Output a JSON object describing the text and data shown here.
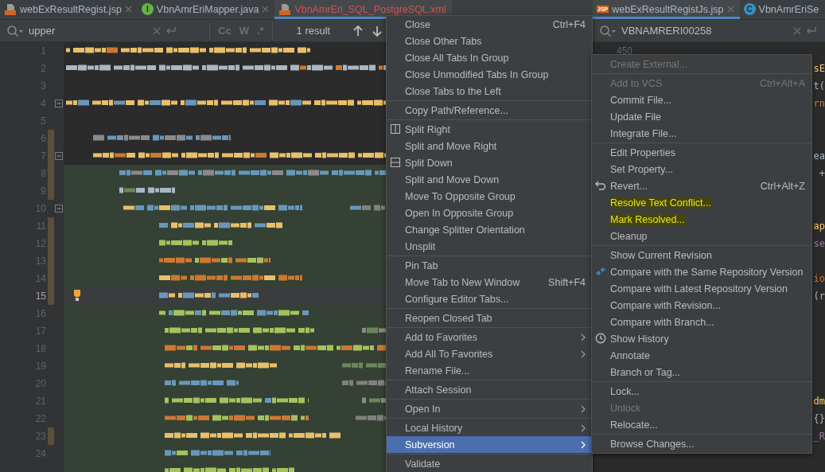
{
  "left_pane": {
    "tabs": [
      {
        "label": "webExResultRegist.jsp",
        "kind": "jsp",
        "selected": false,
        "error": false
      },
      {
        "label": "VbnAmrEriMapper.java",
        "kind": "interface",
        "badge": "I",
        "selected": false,
        "error": false
      },
      {
        "label": "VbnAmrEri_SQL_PostgreSQL.xml",
        "kind": "xml",
        "selected": true,
        "error": true
      }
    ],
    "search": {
      "value": "upper",
      "options": [
        "Cc",
        "W",
        ".*"
      ],
      "result": "1 result"
    },
    "editor": {
      "lines": [
        {
          "number": "1",
          "kind": "code",
          "changed": false,
          "fold": false,
          "highlighted": false,
          "current": false
        },
        {
          "number": "2",
          "kind": "code",
          "changed": false,
          "fold": false,
          "highlighted": false,
          "current": false
        },
        {
          "number": "3",
          "kind": "blank",
          "changed": false,
          "fold": false,
          "highlighted": false,
          "current": false
        },
        {
          "number": "4",
          "kind": "code",
          "changed": false,
          "fold": true,
          "highlighted": false,
          "current": false
        },
        {
          "number": "5",
          "kind": "blank",
          "changed": false,
          "fold": false,
          "highlighted": false,
          "current": false
        },
        {
          "number": "6",
          "kind": "code",
          "changed": true,
          "fold": false,
          "highlighted": false,
          "current": false
        },
        {
          "number": "7",
          "kind": "code",
          "changed": true,
          "fold": true,
          "highlighted": false,
          "current": false
        },
        {
          "number": "8",
          "kind": "code",
          "changed": true,
          "fold": false,
          "highlighted": true,
          "current": false
        },
        {
          "number": "9",
          "kind": "code",
          "changed": true,
          "fold": false,
          "highlighted": true,
          "current": false
        },
        {
          "number": "10",
          "kind": "code",
          "changed": false,
          "fold": true,
          "highlighted": true,
          "current": false
        },
        {
          "number": "11",
          "kind": "code",
          "changed": true,
          "fold": false,
          "highlighted": true,
          "current": false
        },
        {
          "number": "12",
          "kind": "code",
          "changed": true,
          "fold": false,
          "highlighted": true,
          "current": false
        },
        {
          "number": "13",
          "kind": "code",
          "changed": true,
          "fold": false,
          "highlighted": true,
          "current": false
        },
        {
          "number": "14",
          "kind": "code",
          "changed": true,
          "fold": false,
          "highlighted": true,
          "current": false
        },
        {
          "number": "15",
          "kind": "code",
          "changed": true,
          "fold": false,
          "highlighted": true,
          "current": true,
          "bulb": true
        },
        {
          "number": "16",
          "kind": "code",
          "changed": false,
          "fold": false,
          "highlighted": true,
          "current": false
        },
        {
          "number": "17",
          "kind": "code",
          "changed": false,
          "fold": false,
          "highlighted": true,
          "current": false
        },
        {
          "number": "18",
          "kind": "code",
          "changed": false,
          "fold": false,
          "highlighted": true,
          "current": false
        },
        {
          "number": "19",
          "kind": "code",
          "changed": false,
          "fold": false,
          "highlighted": true,
          "current": false
        },
        {
          "number": "20",
          "kind": "code",
          "changed": false,
          "fold": false,
          "highlighted": true,
          "current": false
        },
        {
          "number": "21",
          "kind": "code",
          "changed": false,
          "fold": false,
          "highlighted": true,
          "current": false
        },
        {
          "number": "22",
          "kind": "code",
          "changed": false,
          "fold": false,
          "highlighted": true,
          "current": false
        },
        {
          "number": "23",
          "kind": "code",
          "changed": true,
          "fold": false,
          "highlighted": true,
          "current": false
        },
        {
          "number": "24",
          "kind": "code",
          "changed": false,
          "fold": false,
          "highlighted": true,
          "current": false
        },
        {
          "kind": "code",
          "changed": false,
          "fold": false,
          "highlighted": true,
          "current": false
        }
      ]
    }
  },
  "right_pane": {
    "tabs": [
      {
        "label": "webExResultRegistJs.jsp",
        "kind": "jsp",
        "badge": "JSP",
        "selected": true,
        "error": false
      },
      {
        "label": "VbnAmrEriSe",
        "kind": "class",
        "badge": "C",
        "selected": false,
        "error": false
      }
    ],
    "search": {
      "value": "VBNAMRERI00258"
    },
    "editor": {
      "lines": [
        {
          "number": "450"
        },
        {
          "kind": "tail",
          "code": "sE",
          "color": "#ffc66d"
        },
        {
          "kind": "tail",
          "code": "t(",
          "color": "#a9b7c6"
        },
        {
          "kind": "tail",
          "code": "rn",
          "color": "#cc7832"
        },
        {
          "kind": "tail",
          "code": "ea",
          "color": "#a9b7c6"
        },
        {
          "kind": "tail",
          "code": "+",
          "color": "#a9b7c6"
        },
        {
          "kind": "tail",
          "code": "ap",
          "color": "#ffc66d"
        },
        {
          "kind": "tail",
          "code": "se",
          "color": "#9876aa"
        },
        {
          "kind": "tail",
          "code": "io",
          "color": "#cc7832"
        },
        {
          "kind": "tail",
          "code": "(r",
          "color": "#a9b7c6"
        },
        {
          "kind": "tail",
          "code": "dm",
          "color": "#ffc66d"
        },
        {
          "kind": "tail",
          "code": "{}",
          "color": "#a9b7c6"
        },
        {
          "kind": "tail",
          "code": "_R",
          "color": "#9876aa"
        }
      ]
    }
  },
  "context_menu": {
    "items": [
      {
        "kind": "item",
        "label": "Close",
        "shortcut": "Ctrl+F4"
      },
      {
        "kind": "item",
        "label": "Close Other Tabs"
      },
      {
        "kind": "item",
        "label": "Close All Tabs In Group"
      },
      {
        "kind": "item",
        "label": "Close Unmodified Tabs In Group"
      },
      {
        "kind": "item",
        "label": "Close Tabs to the Left"
      },
      {
        "kind": "separator"
      },
      {
        "kind": "item",
        "label": "Copy Path/Reference..."
      },
      {
        "kind": "separator"
      },
      {
        "kind": "splitright",
        "label": "Split Right"
      },
      {
        "kind": "item",
        "label": "Split and Move Right"
      },
      {
        "kind": "splitdown",
        "label": "Split Down"
      },
      {
        "kind": "item",
        "label": "Split and Move Down"
      },
      {
        "kind": "item",
        "label": "Move To Opposite Group"
      },
      {
        "kind": "item",
        "label": "Open In Opposite Group"
      },
      {
        "kind": "item",
        "label": "Change Splitter Orientation"
      },
      {
        "kind": "item",
        "label": "Unsplit"
      },
      {
        "kind": "separator"
      },
      {
        "kind": "item",
        "label": "Pin Tab"
      },
      {
        "kind": "item",
        "label": "Move Tab to New Window",
        "shortcut": "Shift+F4"
      },
      {
        "kind": "item",
        "label": "Configure Editor Tabs..."
      },
      {
        "kind": "separator"
      },
      {
        "kind": "item",
        "label": "Reopen Closed Tab"
      },
      {
        "kind": "separator"
      },
      {
        "kind": "item",
        "label": "Add to Favorites",
        "submenu": true
      },
      {
        "kind": "item",
        "label": "Add All To Favorites",
        "submenu": true
      },
      {
        "kind": "item",
        "label": "Rename File..."
      },
      {
        "kind": "separator"
      },
      {
        "kind": "item",
        "label": "Attach Session"
      },
      {
        "kind": "separator"
      },
      {
        "kind": "item",
        "label": "Open In",
        "submenu": true
      },
      {
        "kind": "separator"
      },
      {
        "kind": "item",
        "label": "Local History",
        "submenu": true,
        "selected": false
      },
      {
        "kind": "item",
        "label": "Subversion",
        "submenu": true,
        "selected": true
      },
      {
        "kind": "separator"
      },
      {
        "kind": "item",
        "label": "Validate"
      }
    ]
  },
  "submenu": {
    "items": [
      {
        "kind": "item",
        "label": "Create External...",
        "disabled": true
      },
      {
        "kind": "separator"
      },
      {
        "kind": "item",
        "label": "Add to VCS",
        "shortcut": "Ctrl+Alt+A",
        "disabled": true
      },
      {
        "kind": "item",
        "label": "Commit File...",
        "disabled": false
      },
      {
        "kind": "item",
        "label": "Update File"
      },
      {
        "kind": "item",
        "label": "Integrate File..."
      },
      {
        "kind": "separator"
      },
      {
        "kind": "item",
        "label": "Edit Properties"
      },
      {
        "kind": "item",
        "label": "Set Property..."
      },
      {
        "kind": "revert",
        "label": "Revert...",
        "shortcut": "Ctrl+Alt+Z",
        "highlighted": false
      },
      {
        "kind": "item",
        "label": "Resolve Text Conflict...",
        "highlighted": true
      },
      {
        "kind": "item",
        "label": "Mark Resolved...",
        "highlighted": true
      },
      {
        "kind": "item",
        "label": "Cleanup",
        "highlighted": false
      },
      {
        "kind": "separator"
      },
      {
        "kind": "item",
        "label": "Show Current Revision"
      },
      {
        "kind": "compare",
        "label": "Compare with the Same Repository Version"
      },
      {
        "kind": "item",
        "label": "Compare with Latest Repository Version"
      },
      {
        "kind": "item",
        "label": "Compare with Revision..."
      },
      {
        "kind": "item",
        "label": "Compare with Branch..."
      },
      {
        "kind": "history",
        "label": "Show History"
      },
      {
        "kind": "item",
        "label": "Annotate"
      },
      {
        "kind": "item",
        "label": "Branch or Tag..."
      },
      {
        "kind": "separator"
      },
      {
        "kind": "item",
        "label": "Lock...",
        "disabled": false
      },
      {
        "kind": "item",
        "label": "Unlock",
        "disabled": true
      },
      {
        "kind": "item",
        "label": "Relocate..."
      },
      {
        "kind": "separator"
      },
      {
        "kind": "item",
        "label": "Browse Changes..."
      }
    ]
  }
}
